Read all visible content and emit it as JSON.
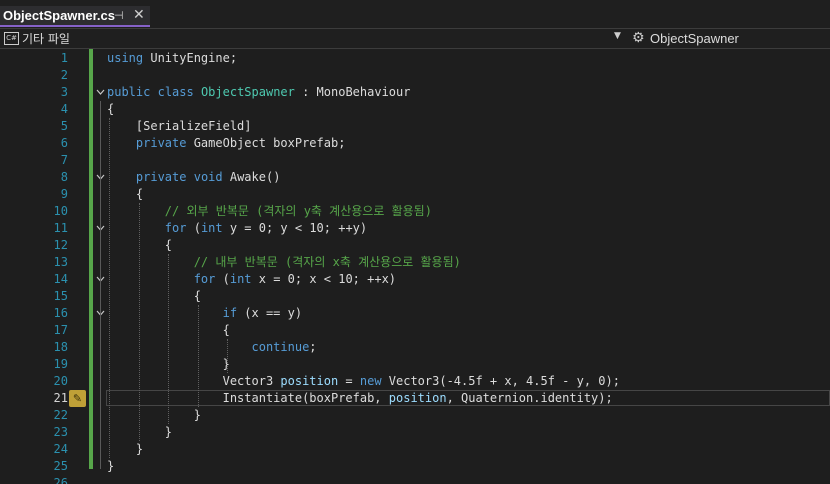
{
  "tab": {
    "title": "ObjectSpawner.cs",
    "pin_icon": "pin-icon",
    "close_icon": "close-icon"
  },
  "navbar": {
    "project": "기타 파일",
    "project_icon": "csharp-project-icon",
    "class_name": "ObjectSpawner",
    "class_icon": "class-icon"
  },
  "editor": {
    "active_line": 21,
    "colors": {
      "keyword": "#569cd6",
      "type": "#4ec9b0",
      "comment": "#57a64a",
      "method": "#dcdcaa",
      "variable": "#9cdcfe",
      "control": "#d8a0df",
      "line_number": "#2b91af",
      "change_bar": "#57a64a"
    },
    "line_numbers": [
      "1",
      "2",
      "3",
      "4",
      "5",
      "6",
      "7",
      "8",
      "9",
      "10",
      "11",
      "12",
      "13",
      "14",
      "15",
      "16",
      "17",
      "18",
      "19",
      "20",
      "21",
      "22",
      "23",
      "24",
      "25",
      "26"
    ],
    "lines": [
      {
        "tokens": [
          {
            "t": "using",
            "c": "kw"
          },
          {
            "t": " UnityEngine;",
            "c": "pl"
          }
        ]
      },
      {
        "tokens": []
      },
      {
        "tokens": [
          {
            "t": "public",
            "c": "kw"
          },
          {
            "t": " ",
            "c": "pl"
          },
          {
            "t": "class",
            "c": "kw"
          },
          {
            "t": " ",
            "c": "pl"
          },
          {
            "t": "ObjectSpawner",
            "c": "cl"
          },
          {
            "t": " : MonoBehaviour",
            "c": "pl"
          }
        ]
      },
      {
        "tokens": [
          {
            "t": "{",
            "c": "pl"
          }
        ]
      },
      {
        "tokens": [
          {
            "t": "    [SerializeField]",
            "c": "pl"
          }
        ]
      },
      {
        "tokens": [
          {
            "t": "    ",
            "c": "pl"
          },
          {
            "t": "private",
            "c": "kw"
          },
          {
            "t": " GameObject boxPrefab;",
            "c": "pl"
          }
        ]
      },
      {
        "tokens": []
      },
      {
        "tokens": [
          {
            "t": "    ",
            "c": "pl"
          },
          {
            "t": "private",
            "c": "kw"
          },
          {
            "t": " ",
            "c": "pl"
          },
          {
            "t": "void",
            "c": "kw"
          },
          {
            "t": " Awake()",
            "c": "pl"
          }
        ]
      },
      {
        "tokens": [
          {
            "t": "    {",
            "c": "pl"
          }
        ]
      },
      {
        "tokens": [
          {
            "t": "        ",
            "c": "pl"
          },
          {
            "t": "// 외부 반복문 (격자의 y축 계산용으로 활용됨)",
            "c": "cm"
          }
        ]
      },
      {
        "tokens": [
          {
            "t": "        ",
            "c": "pl"
          },
          {
            "t": "for",
            "c": "kw"
          },
          {
            "t": " (",
            "c": "pl"
          },
          {
            "t": "int",
            "c": "kw"
          },
          {
            "t": " y = 0; y < 10; ++y)",
            "c": "pl"
          }
        ]
      },
      {
        "tokens": [
          {
            "t": "        {",
            "c": "pl"
          }
        ]
      },
      {
        "tokens": [
          {
            "t": "            ",
            "c": "pl"
          },
          {
            "t": "// 내부 반복문 (격자의 x축 계산용으로 활용됨)",
            "c": "cm"
          }
        ]
      },
      {
        "tokens": [
          {
            "t": "            ",
            "c": "pl"
          },
          {
            "t": "for",
            "c": "kw"
          },
          {
            "t": " (",
            "c": "pl"
          },
          {
            "t": "int",
            "c": "kw"
          },
          {
            "t": " x = 0; x < 10; ++x)",
            "c": "pl"
          }
        ]
      },
      {
        "tokens": [
          {
            "t": "            {",
            "c": "pl"
          }
        ]
      },
      {
        "tokens": [
          {
            "t": "                ",
            "c": "pl"
          },
          {
            "t": "if",
            "c": "kw"
          },
          {
            "t": " (x == y)",
            "c": "pl"
          }
        ]
      },
      {
        "tokens": [
          {
            "t": "                {",
            "c": "pl"
          }
        ]
      },
      {
        "tokens": [
          {
            "t": "                    ",
            "c": "pl"
          },
          {
            "t": "continue",
            "c": "kw"
          },
          {
            "t": ";",
            "c": "pl"
          }
        ]
      },
      {
        "tokens": [
          {
            "t": "                }",
            "c": "pl"
          }
        ]
      },
      {
        "tokens": [
          {
            "t": "                Vector3 ",
            "c": "pl"
          },
          {
            "t": "position",
            "c": "var"
          },
          {
            "t": " = ",
            "c": "pl"
          },
          {
            "t": "new",
            "c": "kw"
          },
          {
            "t": " Vector3(-4.5f + x, 4.5f - y, 0);",
            "c": "pl"
          }
        ]
      },
      {
        "tokens": [
          {
            "t": "                Instantiate(boxPrefab, ",
            "c": "pl"
          },
          {
            "t": "position",
            "c": "var"
          },
          {
            "t": ", Quaternion.identity);",
            "c": "pl"
          }
        ]
      },
      {
        "tokens": [
          {
            "t": "            }",
            "c": "pl"
          }
        ]
      },
      {
        "tokens": [
          {
            "t": "        }",
            "c": "pl"
          }
        ]
      },
      {
        "tokens": [
          {
            "t": "    }",
            "c": "pl"
          }
        ]
      },
      {
        "tokens": [
          {
            "t": "}",
            "c": "pl"
          }
        ]
      },
      {
        "tokens": []
      }
    ]
  }
}
